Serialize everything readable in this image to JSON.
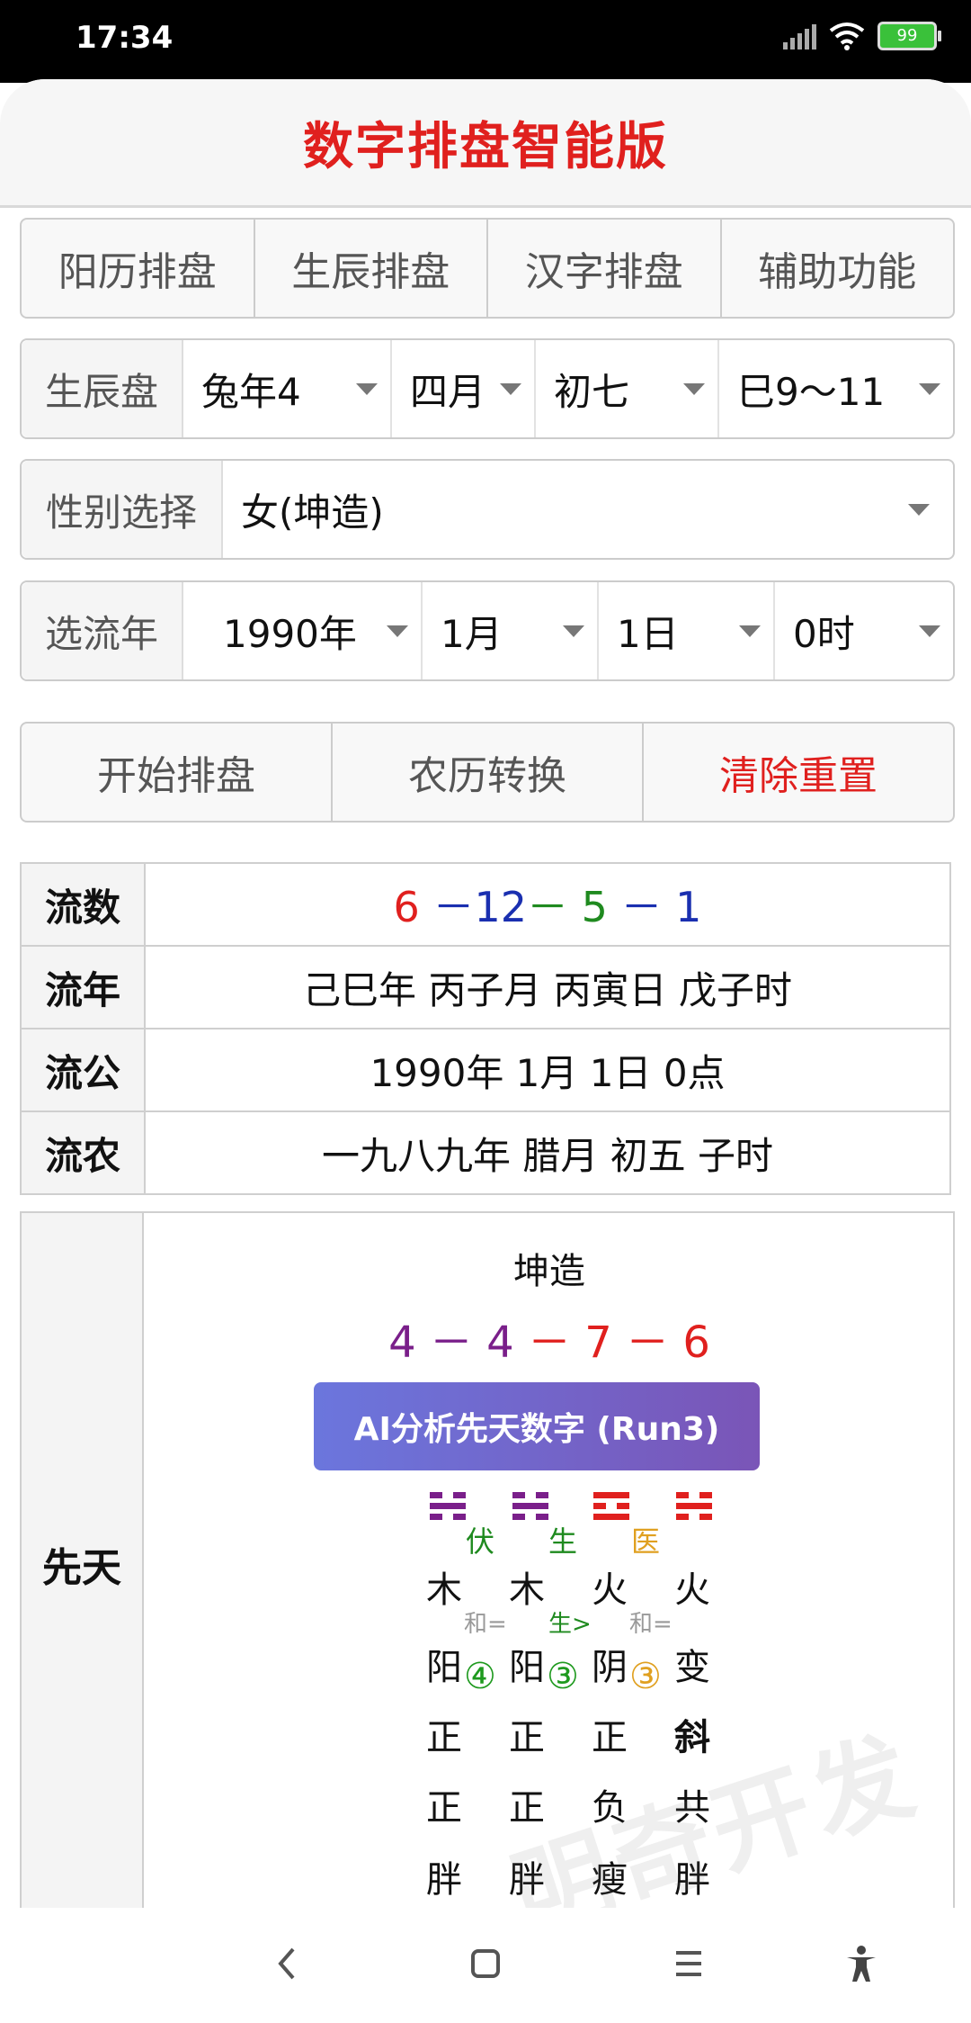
{
  "status": {
    "time": "17:34",
    "battery": "99"
  },
  "header": {
    "title": "数字排盘智能版"
  },
  "tabs": [
    "阳历排盘",
    "生辰排盘",
    "汉字排盘",
    "辅助功能"
  ],
  "birth_row": {
    "label": "生辰盘",
    "year": "兔年4",
    "month": "四月",
    "day": "初七",
    "hour": "巳9～11"
  },
  "gender_row": {
    "label": "性别选择",
    "value": "女(坤造)"
  },
  "flow_row": {
    "label": "选流年",
    "year": "1990年",
    "month": "1月",
    "day": "1日",
    "hour": "0时"
  },
  "actions": {
    "start": "开始排盘",
    "convert": "农历转换",
    "reset": "清除重置"
  },
  "info": {
    "liushu_label": "流数",
    "liushu": {
      "n1": "6",
      "d1": "－",
      "n2": "12",
      "d2": "－",
      "n3": "5",
      "d3": "－",
      "n4": "1"
    },
    "liunian_label": "流年",
    "liunian": "己巳年 丙子月 丙寅日 戊子时",
    "liugong_label": "流公",
    "liugong": "1990年 1月 1日 0点",
    "liunong_label": "流农",
    "liunong": "一九八九年 腊月 初五 子时"
  },
  "xiantian": {
    "label": "先天",
    "title": "坤造",
    "seq": {
      "n1": "4",
      "d1": "－",
      "n2": "4",
      "d2": "－",
      "n3": "7",
      "d3": "－",
      "n4": "6"
    },
    "ai_button": "AI分析先天数字 (Run3)",
    "rel_top": [
      "伏",
      "生",
      "医"
    ],
    "elements": [
      "木",
      "木",
      "火",
      "火"
    ],
    "rel_mid": [
      "和=",
      "生>",
      "和="
    ],
    "yinyang": [
      "阳",
      "阳",
      "阴",
      "变"
    ],
    "circled": [
      "④",
      "③",
      "③"
    ],
    "row3": [
      "正",
      "正",
      "正",
      "斜"
    ],
    "row4": [
      "正",
      "正",
      "负",
      "共"
    ],
    "row5": [
      "胖",
      "胖",
      "瘦",
      "胖"
    ]
  },
  "watermark": "明奇开发",
  "colors": {
    "red": "#e0201e",
    "blue": "#1a2fb0",
    "green": "#1f8a1f",
    "purple": "#7a1f8a",
    "gold": "#e0a020"
  }
}
